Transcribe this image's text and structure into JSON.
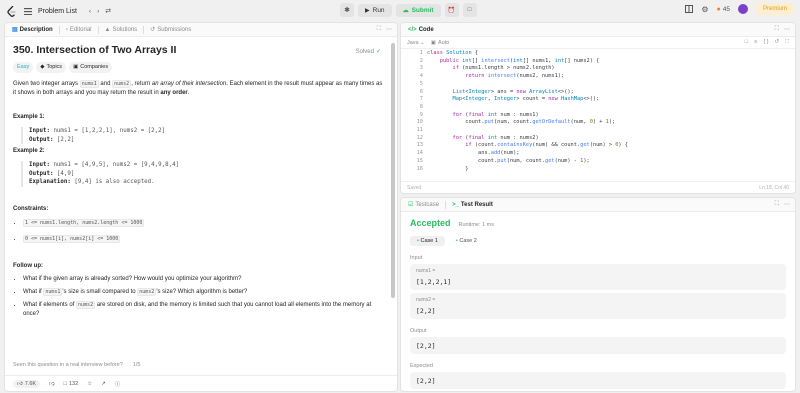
{
  "topbar": {
    "problem_list": "Problem List",
    "run": "Run",
    "submit": "Submit",
    "streak": "45",
    "premium": "Premium"
  },
  "desc": {
    "tabs": [
      "Description",
      "Editorial",
      "Solutions",
      "Submissions"
    ],
    "title": "350. Intersection of Two Arrays II",
    "solved": "Solved",
    "tags": [
      "Easy",
      "Topics",
      "Companies"
    ],
    "p1a": "Given two integer arrays ",
    "nums1": "nums1",
    "p1b": " and ",
    "nums2": "nums2",
    "p1c": ", return ",
    "p1d": "an array of their intersection",
    "p1e": ". Each element in the result must appear as many times as it shows in both arrays and you may return the result in ",
    "p1f": "any order",
    "p1g": ".",
    "ex1_title": "Example 1:",
    "ex1_in_k": "Input:",
    "ex1_in_v": " nums1 = [1,2,2,1], nums2 = [2,2]",
    "ex1_out_k": "Output:",
    "ex1_out_v": " [2,2]",
    "ex2_title": "Example 2:",
    "ex2_in_k": "Input:",
    "ex2_in_v": " nums1 = [4,9,5], nums2 = [9,4,9,8,4]",
    "ex2_out_k": "Output:",
    "ex2_out_v": " [4,9]",
    "ex2_exp_k": "Explanation:",
    "ex2_exp_v": " [9,4] is also accepted.",
    "constraints_title": "Constraints:",
    "c1": "1 <= nums1.length, nums2.length <= 1000",
    "c2": "0 <= nums1[i], nums2[i] <= 1000",
    "followup_title": "Follow up:",
    "f1": "What if the given array is already sorted? How would you optimize your algorithm?",
    "f2a": "What if ",
    "f2b": "'s size is small compared to ",
    "f2c": "'s size? Which algorithm is better?",
    "f3a": "What if elements of ",
    "f3b": " are stored on disk, and the memory is limited such that you cannot load all elements into the memory at once?",
    "interview": "Seen this question in a real interview before?",
    "interview_count": "1/5",
    "likes": "7.6K",
    "comments": "132"
  },
  "code": {
    "tab": "Code",
    "lang": "Java",
    "mode": "Auto",
    "lines": [
      "class Solution {",
      "    public int[] intersect(int[] nums1, int[] nums2) {",
      "        if (nums1.length > nums2.length)",
      "            return intersect(nums2, nums1);",
      "",
      "        List<Integer> ans = new ArrayList<>();",
      "        Map<Integer, Integer> count = new HashMap<>();",
      "",
      "        for (final int num : nums1)",
      "            count.put(num, count.getOrDefault(num, 0) + 1);",
      "",
      "        for (final int num : nums2)",
      "            if (count.containsKey(num) && count.get(num) > 0) {",
      "                ans.add(num);",
      "                count.put(num, count.get(num) - 1);",
      "            }"
    ],
    "status_left": "Saved",
    "status_right": "Ln 18, Col 40"
  },
  "result": {
    "tabs": [
      "Testcase",
      "Test Result"
    ],
    "accepted": "Accepted",
    "runtime": "Runtime: 1 ms",
    "cases": [
      "Case 1",
      "Case 2"
    ],
    "input_label": "Input",
    "nums1_label": "nums1 =",
    "nums1_val": "[1,2,2,1]",
    "nums2_label": "nums2 =",
    "nums2_val": "[2,2]",
    "output_label": "Output",
    "output_val": "[2,2]",
    "expected_label": "Expected",
    "expected_val": "[2,2]"
  }
}
